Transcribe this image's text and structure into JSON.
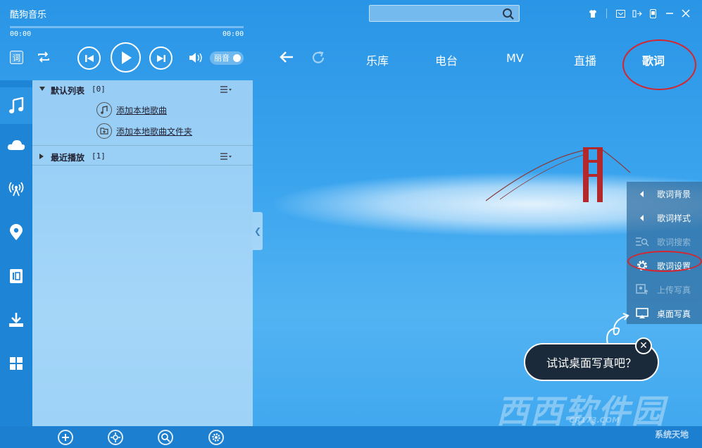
{
  "app": {
    "title": "酷狗音乐"
  },
  "search": {
    "placeholder": ""
  },
  "player": {
    "current_time": "00:00",
    "total_time": "00:00",
    "progress": 0,
    "lyric_toggle": "词",
    "quality_label": "丽音"
  },
  "nav": {
    "tabs": [
      {
        "label": "乐库"
      },
      {
        "label": "电台"
      },
      {
        "label": "MV"
      },
      {
        "label": "直播"
      },
      {
        "label": "歌词"
      }
    ],
    "active_tab": "歌词"
  },
  "playlist": {
    "default_list": {
      "name": "默认列表",
      "count": "[0]"
    },
    "add_song": "添加本地歌曲",
    "add_folder": "添加本地歌曲文件夹",
    "recent": {
      "name": "最近播放",
      "count": "[1]"
    }
  },
  "lyric_menu": {
    "items": [
      {
        "label": "歌词背景",
        "icon": "caret-left-icon",
        "enabled": true
      },
      {
        "label": "歌词样式",
        "icon": "caret-left-icon",
        "enabled": true
      },
      {
        "label": "歌词搜索",
        "icon": "list-search-icon",
        "enabled": false
      },
      {
        "label": "歌词设置",
        "icon": "gear-icon",
        "enabled": true
      },
      {
        "label": "上传写真",
        "icon": "upload-photo-icon",
        "enabled": false
      },
      {
        "label": "桌面写真",
        "icon": "desktop-photo-icon",
        "enabled": true
      }
    ]
  },
  "tooltip": {
    "text": "试试桌面写真吧？",
    "close": "✕"
  },
  "watermark": {
    "logo": "西西软件园",
    "url": "CR173.COM",
    "badge": "系统天地"
  },
  "colors": {
    "accent_red": "#d8242c",
    "rail": "#1e84d6",
    "bottom_bar": "#1d7fd0"
  }
}
